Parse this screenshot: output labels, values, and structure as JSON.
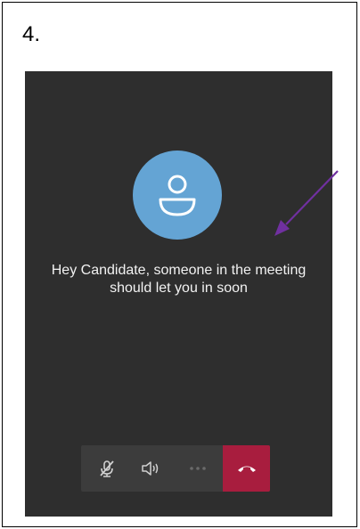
{
  "step_label": "4.",
  "lobby": {
    "message_line1": "Hey Candidate, someone in the meeting",
    "message_line2": "should let you in soon"
  },
  "controls": {
    "mic_icon": "mic-off-icon",
    "speaker_icon": "speaker-icon",
    "more_icon": "more-options-icon",
    "hangup_icon": "hang-up-icon"
  },
  "colors": {
    "background": "#2e2e2e",
    "avatar": "#64a4d4",
    "hangup": "#a81d3e",
    "arrow": "#7030a0"
  }
}
